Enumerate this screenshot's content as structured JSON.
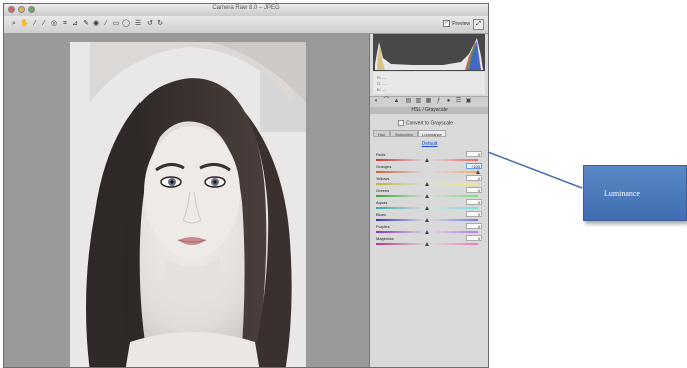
{
  "window": {
    "title": "Camera Raw 8.0 – JPEG"
  },
  "toolbar": {
    "preview_label": "Preview",
    "preview_checked": "✓",
    "tools": [
      "zoom-icon",
      "hand-icon",
      "white-balance-icon",
      "color-sampler-icon",
      "targeted-adjustment-icon",
      "crop-icon",
      "straighten-icon",
      "spot-removal-icon",
      "red-eye-icon",
      "adjustment-brush-icon",
      "graduated-filter-icon",
      "radial-filter-icon",
      "preferences-icon",
      "rotate-ccw-icon",
      "rotate-cw-icon"
    ]
  },
  "readout": {
    "r": "R: ---",
    "g": "G: ---",
    "b": "B: ---"
  },
  "panel": {
    "section_title": "HSL / Grayscale",
    "convert_label": "Convert to Grayscale",
    "tabs": [
      "Hue",
      "Saturation",
      "Luminance"
    ],
    "active_tab": "Luminance",
    "default_label": "Default",
    "sliders": [
      {
        "label": "Reds",
        "value": "0",
        "position": 0.5,
        "colors": [
          "#c33",
          "#ddd",
          "#e66"
        ]
      },
      {
        "label": "Oranges",
        "value": "+100",
        "position": 1.0,
        "selected": true,
        "colors": [
          "#c63",
          "#ddd",
          "#ea7"
        ]
      },
      {
        "label": "Yellows",
        "value": "0",
        "position": 0.5,
        "colors": [
          "#bb3",
          "#ddd",
          "#ee7"
        ]
      },
      {
        "label": "Greens",
        "value": "0",
        "position": 0.5,
        "colors": [
          "#3a3",
          "#ddd",
          "#7d7"
        ]
      },
      {
        "label": "Aquas",
        "value": "0",
        "position": 0.5,
        "colors": [
          "#3aa",
          "#ddd",
          "#7dd"
        ]
      },
      {
        "label": "Blues",
        "value": "0",
        "position": 0.5,
        "colors": [
          "#33b",
          "#ddd",
          "#77e"
        ]
      },
      {
        "label": "Purples",
        "value": "0",
        "position": 0.5,
        "colors": [
          "#83b",
          "#ddd",
          "#b7e"
        ]
      },
      {
        "label": "Magentas",
        "value": "0",
        "position": 0.5,
        "colors": [
          "#b38",
          "#ddd",
          "#e7b"
        ]
      }
    ]
  },
  "callout": {
    "text": "Luminance"
  }
}
